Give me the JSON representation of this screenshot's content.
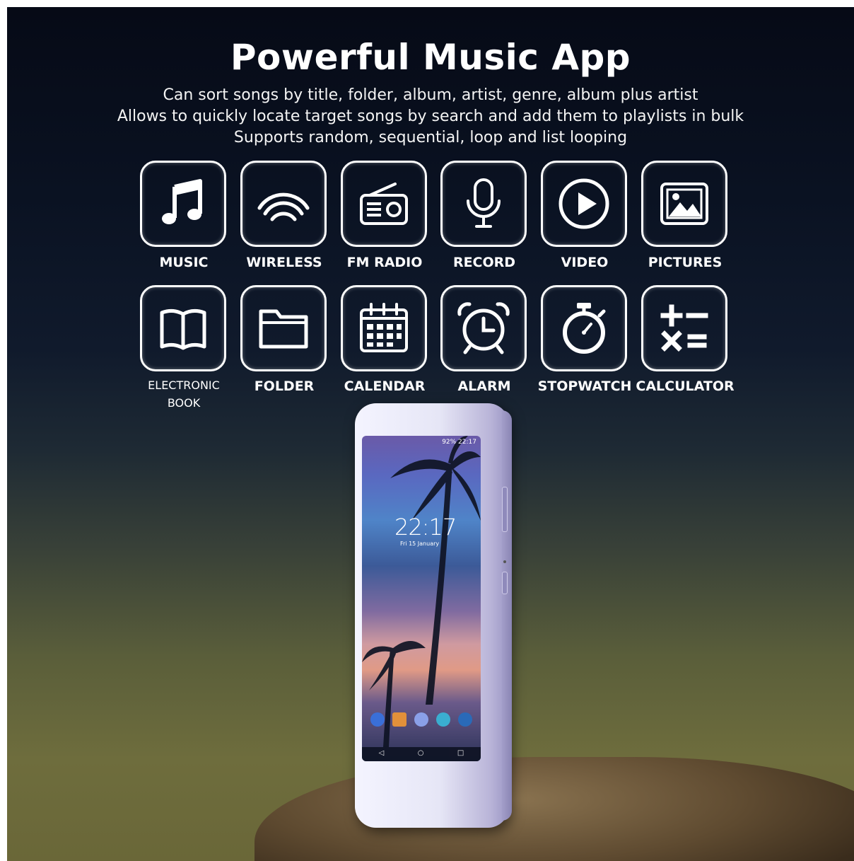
{
  "title": "Powerful Music App",
  "subtitle_lines": [
    "Can sort songs by title, folder, album, artist, genre, album plus artist",
    "Allows to quickly locate target songs by search and add them to playlists in bulk",
    "Supports random, sequential, loop and list looping"
  ],
  "apps": [
    {
      "label": "MUSIC",
      "icon": "music-note-icon"
    },
    {
      "label": "WIRELESS",
      "icon": "wireless-icon"
    },
    {
      "label": "FM RADIO",
      "icon": "radio-icon"
    },
    {
      "label": "RECORD",
      "icon": "microphone-icon"
    },
    {
      "label": "VIDEO",
      "icon": "play-icon"
    },
    {
      "label": "PICTURES",
      "icon": "picture-icon"
    },
    {
      "label_line1": "ELECTRONIC",
      "label_line2": "BOOK",
      "icon": "book-icon"
    },
    {
      "label": "FOLDER",
      "icon": "folder-icon"
    },
    {
      "label": "CALENDAR",
      "icon": "calendar-icon"
    },
    {
      "label": "ALARM",
      "icon": "alarm-clock-icon"
    },
    {
      "label": "STOPWATCH",
      "icon": "stopwatch-icon"
    },
    {
      "label": "CALCULATOR",
      "icon": "calculator-icon"
    }
  ],
  "phone": {
    "status_bar": "92%  22:17",
    "time": "22:17",
    "date": "Fri 15 January",
    "nav": [
      "◁",
      "○",
      "□"
    ]
  },
  "colors": {
    "icon_stroke": "#ffffff",
    "background_top": "#060a16",
    "background_bottom": "#6a6738",
    "phone_body": "#b9b4d8"
  }
}
